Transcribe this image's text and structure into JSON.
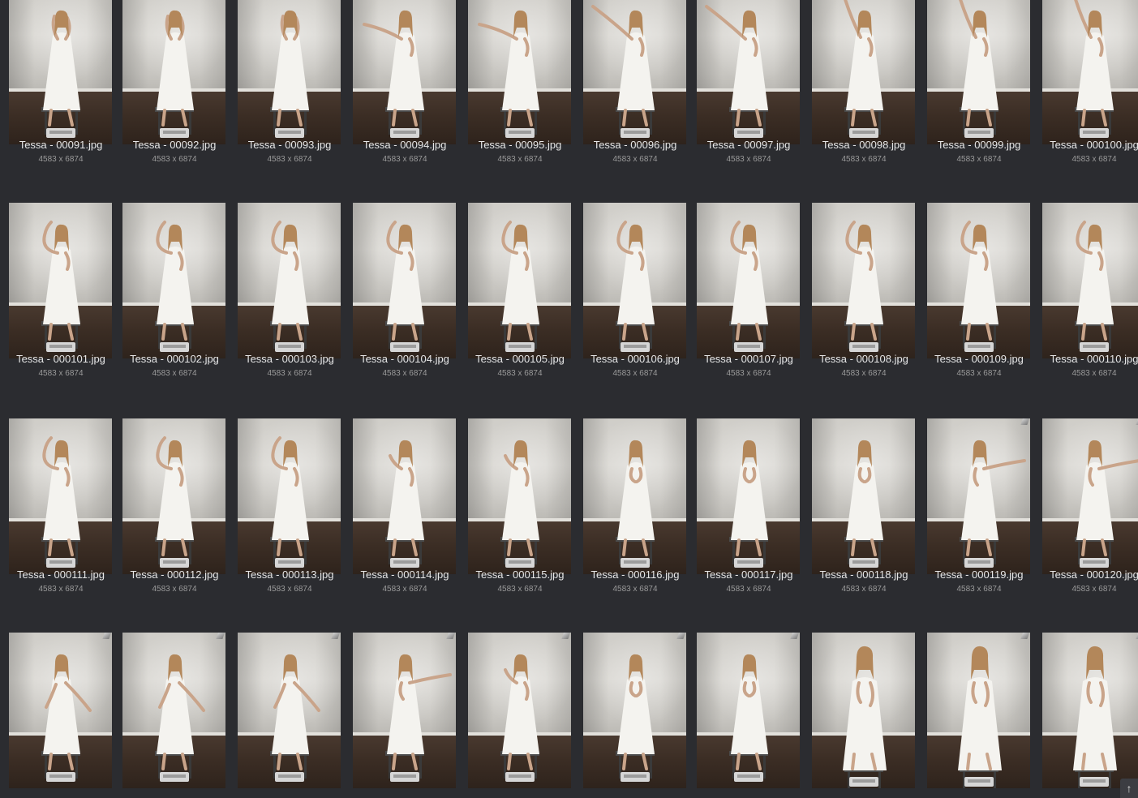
{
  "gallery": {
    "items": [
      {
        "filename": "Tessa - 00091.jpg",
        "dimensions": "4583 x 6874",
        "pose": "hair"
      },
      {
        "filename": "Tessa - 00092.jpg",
        "dimensions": "4583 x 6874",
        "pose": "hair"
      },
      {
        "filename": "Tessa - 00093.jpg",
        "dimensions": "4583 x 6874",
        "pose": "hair"
      },
      {
        "filename": "Tessa - 00094.jpg",
        "dimensions": "4583 x 6874",
        "pose": "reach-left"
      },
      {
        "filename": "Tessa - 00095.jpg",
        "dimensions": "4583 x 6874",
        "pose": "reach-left"
      },
      {
        "filename": "Tessa - 00096.jpg",
        "dimensions": "4583 x 6874",
        "pose": "reach-left-high"
      },
      {
        "filename": "Tessa - 00097.jpg",
        "dimensions": "4583 x 6874",
        "pose": "reach-left-high"
      },
      {
        "filename": "Tessa - 00098.jpg",
        "dimensions": "4583 x 6874",
        "pose": "arm-up"
      },
      {
        "filename": "Tessa - 00099.jpg",
        "dimensions": "4583 x 6874",
        "pose": "arm-up"
      },
      {
        "filename": "Tessa - 000100.jpg",
        "dimensions": "4583 x 6874",
        "pose": "arm-up"
      },
      {
        "filename": "Tessa - 000101.jpg",
        "dimensions": "4583 x 6874",
        "pose": "arm-bent"
      },
      {
        "filename": "Tessa - 000102.jpg",
        "dimensions": "4583 x 6874",
        "pose": "arm-bent"
      },
      {
        "filename": "Tessa - 000103.jpg",
        "dimensions": "4583 x 6874",
        "pose": "arm-bent"
      },
      {
        "filename": "Tessa - 000104.jpg",
        "dimensions": "4583 x 6874",
        "pose": "arm-bent"
      },
      {
        "filename": "Tessa - 000105.jpg",
        "dimensions": "4583 x 6874",
        "pose": "arm-bent"
      },
      {
        "filename": "Tessa - 000106.jpg",
        "dimensions": "4583 x 6874",
        "pose": "arm-bent"
      },
      {
        "filename": "Tessa - 000107.jpg",
        "dimensions": "4583 x 6874",
        "pose": "arm-bent"
      },
      {
        "filename": "Tessa - 000108.jpg",
        "dimensions": "4583 x 6874",
        "pose": "arm-bent"
      },
      {
        "filename": "Tessa - 000109.jpg",
        "dimensions": "4583 x 6874",
        "pose": "arm-bent"
      },
      {
        "filename": "Tessa - 000110.jpg",
        "dimensions": "4583 x 6874",
        "pose": "arm-bent"
      },
      {
        "filename": "Tessa - 000111.jpg",
        "dimensions": "4583 x 6874",
        "pose": "arm-bent"
      },
      {
        "filename": "Tessa - 000112.jpg",
        "dimensions": "4583 x 6874",
        "pose": "arm-bent"
      },
      {
        "filename": "Tessa - 000113.jpg",
        "dimensions": "4583 x 6874",
        "pose": "arm-bent"
      },
      {
        "filename": "Tessa - 000114.jpg",
        "dimensions": "4583 x 6874",
        "pose": "arm-low"
      },
      {
        "filename": "Tessa - 000115.jpg",
        "dimensions": "4583 x 6874",
        "pose": "arm-low"
      },
      {
        "filename": "Tessa - 000116.jpg",
        "dimensions": "4583 x 6874",
        "pose": "hands-in"
      },
      {
        "filename": "Tessa - 000117.jpg",
        "dimensions": "4583 x 6874",
        "pose": "hands-in"
      },
      {
        "filename": "Tessa - 000118.jpg",
        "dimensions": "4583 x 6874",
        "pose": "hands-in"
      },
      {
        "filename": "Tessa - 000119.jpg",
        "dimensions": "4583 x 6874",
        "pose": "reach-right"
      },
      {
        "filename": "Tessa - 000120.jpg",
        "dimensions": "4583 x 6874",
        "pose": "reach-right"
      },
      {
        "filename": "",
        "dimensions": "",
        "pose": "lean-down"
      },
      {
        "filename": "",
        "dimensions": "",
        "pose": "lean-down"
      },
      {
        "filename": "",
        "dimensions": "",
        "pose": "lean-down"
      },
      {
        "filename": "",
        "dimensions": "",
        "pose": "reach-right"
      },
      {
        "filename": "",
        "dimensions": "",
        "pose": "arm-low"
      },
      {
        "filename": "",
        "dimensions": "",
        "pose": "hands-in"
      },
      {
        "filename": "",
        "dimensions": "",
        "pose": "hands-in"
      },
      {
        "filename": "",
        "dimensions": "",
        "pose": "close"
      },
      {
        "filename": "",
        "dimensions": "",
        "pose": "close"
      },
      {
        "filename": "",
        "dimensions": "",
        "pose": "close"
      }
    ]
  },
  "scroll_top": {
    "icon": "arrow-up-icon",
    "glyph": "↑"
  },
  "colors": {
    "background": "#2b2c30",
    "filename_text": "#e6e6e6",
    "dimensions_text": "#9a9a9a"
  }
}
